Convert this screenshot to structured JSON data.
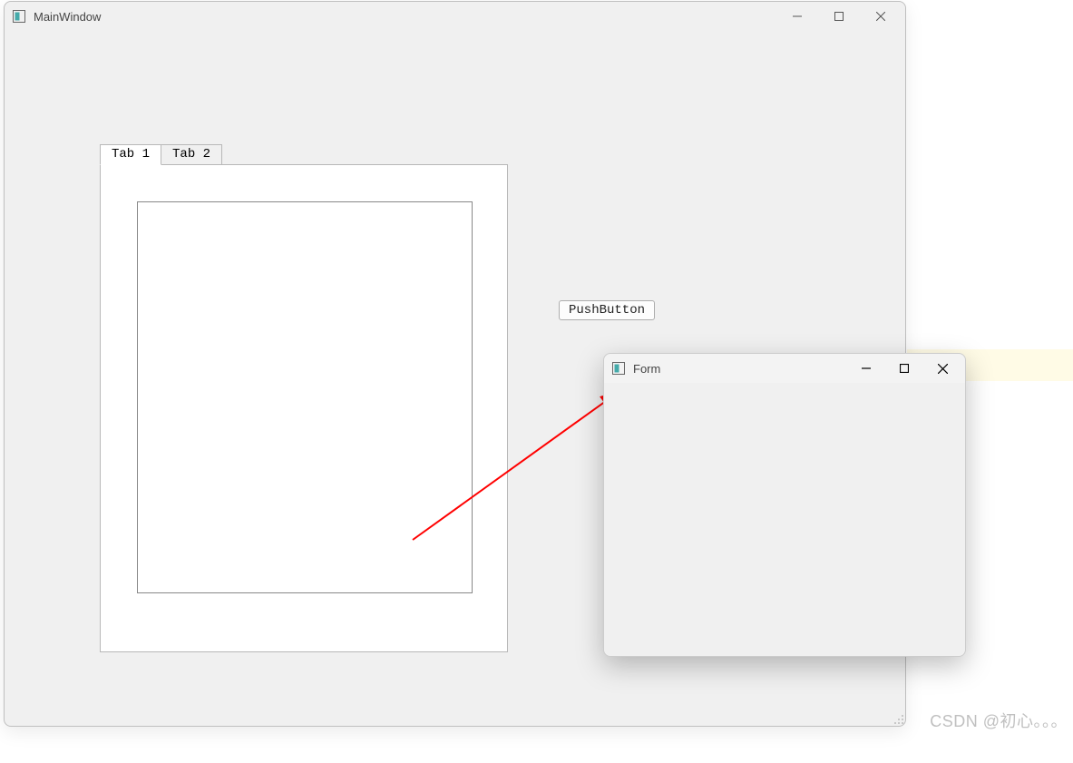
{
  "mainWindow": {
    "title": "MainWindow",
    "tabs": [
      "Tab 1",
      "Tab 2"
    ],
    "activeTab": 0,
    "pushButton": "PushButton"
  },
  "formWindow": {
    "title": "Form"
  },
  "watermark": "CSDN @初心。。。"
}
